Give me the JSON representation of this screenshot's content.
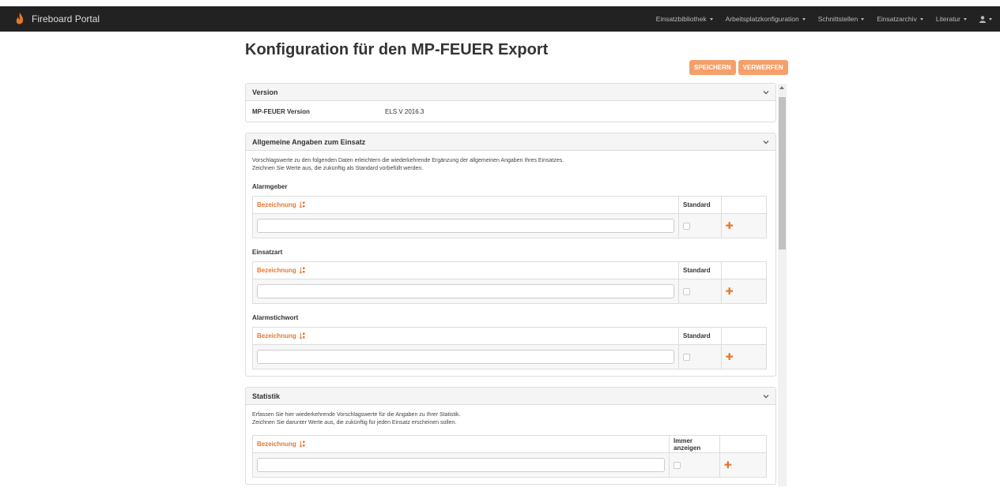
{
  "navbar": {
    "brand": "Fireboard Portal",
    "items": [
      {
        "label": "Einsatzbibliothek"
      },
      {
        "label": "Arbeitsplatzkonfiguration"
      },
      {
        "label": "Schnittstellen"
      },
      {
        "label": "Einsatzarchiv"
      },
      {
        "label": "Literatur"
      }
    ]
  },
  "page": {
    "title": "Konfiguration für den MP-FEUER Export",
    "save_label": "SPEICHERN",
    "discard_label": "VERWERFEN"
  },
  "version_panel": {
    "title": "Version",
    "key": "MP-FEUER Version",
    "value": "ELS V 2016.3"
  },
  "general_panel": {
    "title": "Allgemeine Angaben zum Einsatz",
    "desc1": "Vorschlagswerte zu den folgenden Daten erleichtern die wiederkehrende Ergänzung der allgemeinen Angaben Ihres Einsatzes.",
    "desc2": "Zeichnen Sie Werte aus, die zukünftig als Standard vorbefüllt werden.",
    "sections": [
      {
        "label": "Alarmgeber",
        "col_name": "Bezeichnung",
        "col_default": "Standard"
      },
      {
        "label": "Einsatzart",
        "col_name": "Bezeichnung",
        "col_default": "Standard"
      },
      {
        "label": "Alarmstichwort",
        "col_name": "Bezeichnung",
        "col_default": "Standard"
      }
    ]
  },
  "stats_panel": {
    "title": "Statistik",
    "desc1": "Erfassen Sie hier wiederkehrende Vorschlagswerte für die Angaben zu Ihrer Statistik.",
    "desc2": "Zeichnen Sie darunter Werte aus, die zukünftig für jeden Einsatz erscheinen sollen.",
    "col_name": "Bezeichnung",
    "col_show": "Immer anzeigen"
  },
  "colors": {
    "accent": "#e8762d",
    "button": "#f4a06b",
    "navbar": "#222222"
  }
}
